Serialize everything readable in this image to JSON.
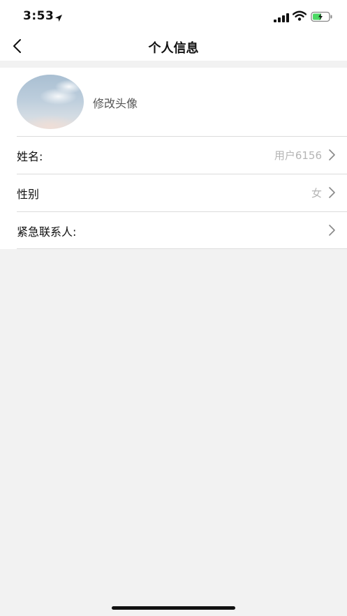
{
  "status_bar": {
    "time": "3:53"
  },
  "nav": {
    "title": "个人信息"
  },
  "profile": {
    "avatar_label": "修改头像",
    "rows": [
      {
        "label": "姓名:",
        "value": "用户6156"
      },
      {
        "label": "性别",
        "value": "女"
      },
      {
        "label": "紧急联系人:",
        "value": ""
      }
    ]
  }
}
